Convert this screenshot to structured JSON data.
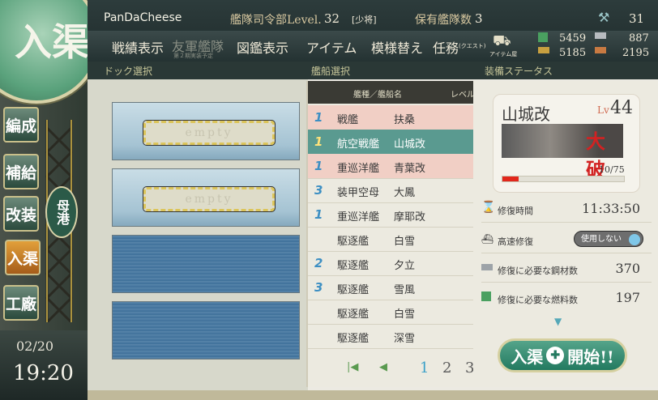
{
  "topbar": {
    "player_name": "PanDaCheese",
    "hq_label": "艦隊司令部Level.",
    "hq_level": "32",
    "rank": "[少将]",
    "fleet_label": "保有艦隊数",
    "fleet_count": "3",
    "dev_material": "31",
    "nav": [
      "戦績表示",
      "友軍艦隊",
      "図鑑表示",
      "アイテム",
      "模様替え",
      "任務"
    ],
    "nav_friend_sub": "第２期実装予定",
    "quest_sub": "(クエスト)",
    "item_shop": "アイテム屋",
    "fuel": "5459",
    "ammo": "5185",
    "steel": "887",
    "bauxite": "2195"
  },
  "sections": {
    "dock": "ドック選択",
    "ship": "艦船選択",
    "status": "装備ステータス"
  },
  "left": {
    "big_label": "入渠",
    "buttons": [
      "編成",
      "補給",
      "改装",
      "入渠",
      "工廠"
    ],
    "port": "母港",
    "date": "02/20",
    "time": "19:20"
  },
  "docks": [
    {
      "state": "empty",
      "label": "empty"
    },
    {
      "state": "empty",
      "label": "empty"
    },
    {
      "state": "locked",
      "label": ""
    },
    {
      "state": "locked",
      "label": ""
    }
  ],
  "list": {
    "header_type": "艦種／艦船名",
    "header_level": "レベル",
    "rows": [
      {
        "badge": "1",
        "type": "戦艦",
        "name": "扶桑",
        "sel": false,
        "dmg": true
      },
      {
        "badge": "1",
        "type": "航空戦艦",
        "name": "山城改",
        "sel": true,
        "dmg": false
      },
      {
        "badge": "1",
        "type": "重巡洋艦",
        "name": "青葉改",
        "sel": false,
        "dmg": true
      },
      {
        "badge": "3",
        "type": "装甲空母",
        "name": "大鳳",
        "sel": false,
        "dmg": false
      },
      {
        "badge": "1",
        "type": "重巡洋艦",
        "name": "摩耶改",
        "sel": false,
        "dmg": false
      },
      {
        "badge": "",
        "type": "駆逐艦",
        "name": "白雪",
        "sel": false,
        "dmg": false
      },
      {
        "badge": "2",
        "type": "駆逐艦",
        "name": "夕立",
        "sel": false,
        "dmg": false
      },
      {
        "badge": "3",
        "type": "駆逐艦",
        "name": "雪風",
        "sel": false,
        "dmg": false
      },
      {
        "badge": "",
        "type": "駆逐艦",
        "name": "白雪",
        "sel": false,
        "dmg": false
      },
      {
        "badge": "",
        "type": "駆逐艦",
        "name": "深雪",
        "sel": false,
        "dmg": false
      }
    ],
    "pages": [
      "1",
      "2",
      "3"
    ]
  },
  "status": {
    "ship_name": "山城改",
    "lv_label": "Lv",
    "level": "44",
    "hp": "10/75",
    "hp_fraction": 0.13,
    "damage_stamp": "大破",
    "repair_time_label": "修復時間",
    "repair_time": "11:33:50",
    "fast_repair_label": "高速修復",
    "fast_repair_toggle": "使用しない",
    "steel_label": "修復に必要な鋼材数",
    "steel": "370",
    "fuel_label": "修復に必要な燃料数",
    "fuel": "197",
    "start_button_a": "入渠",
    "start_button_b": "開始!!"
  }
}
